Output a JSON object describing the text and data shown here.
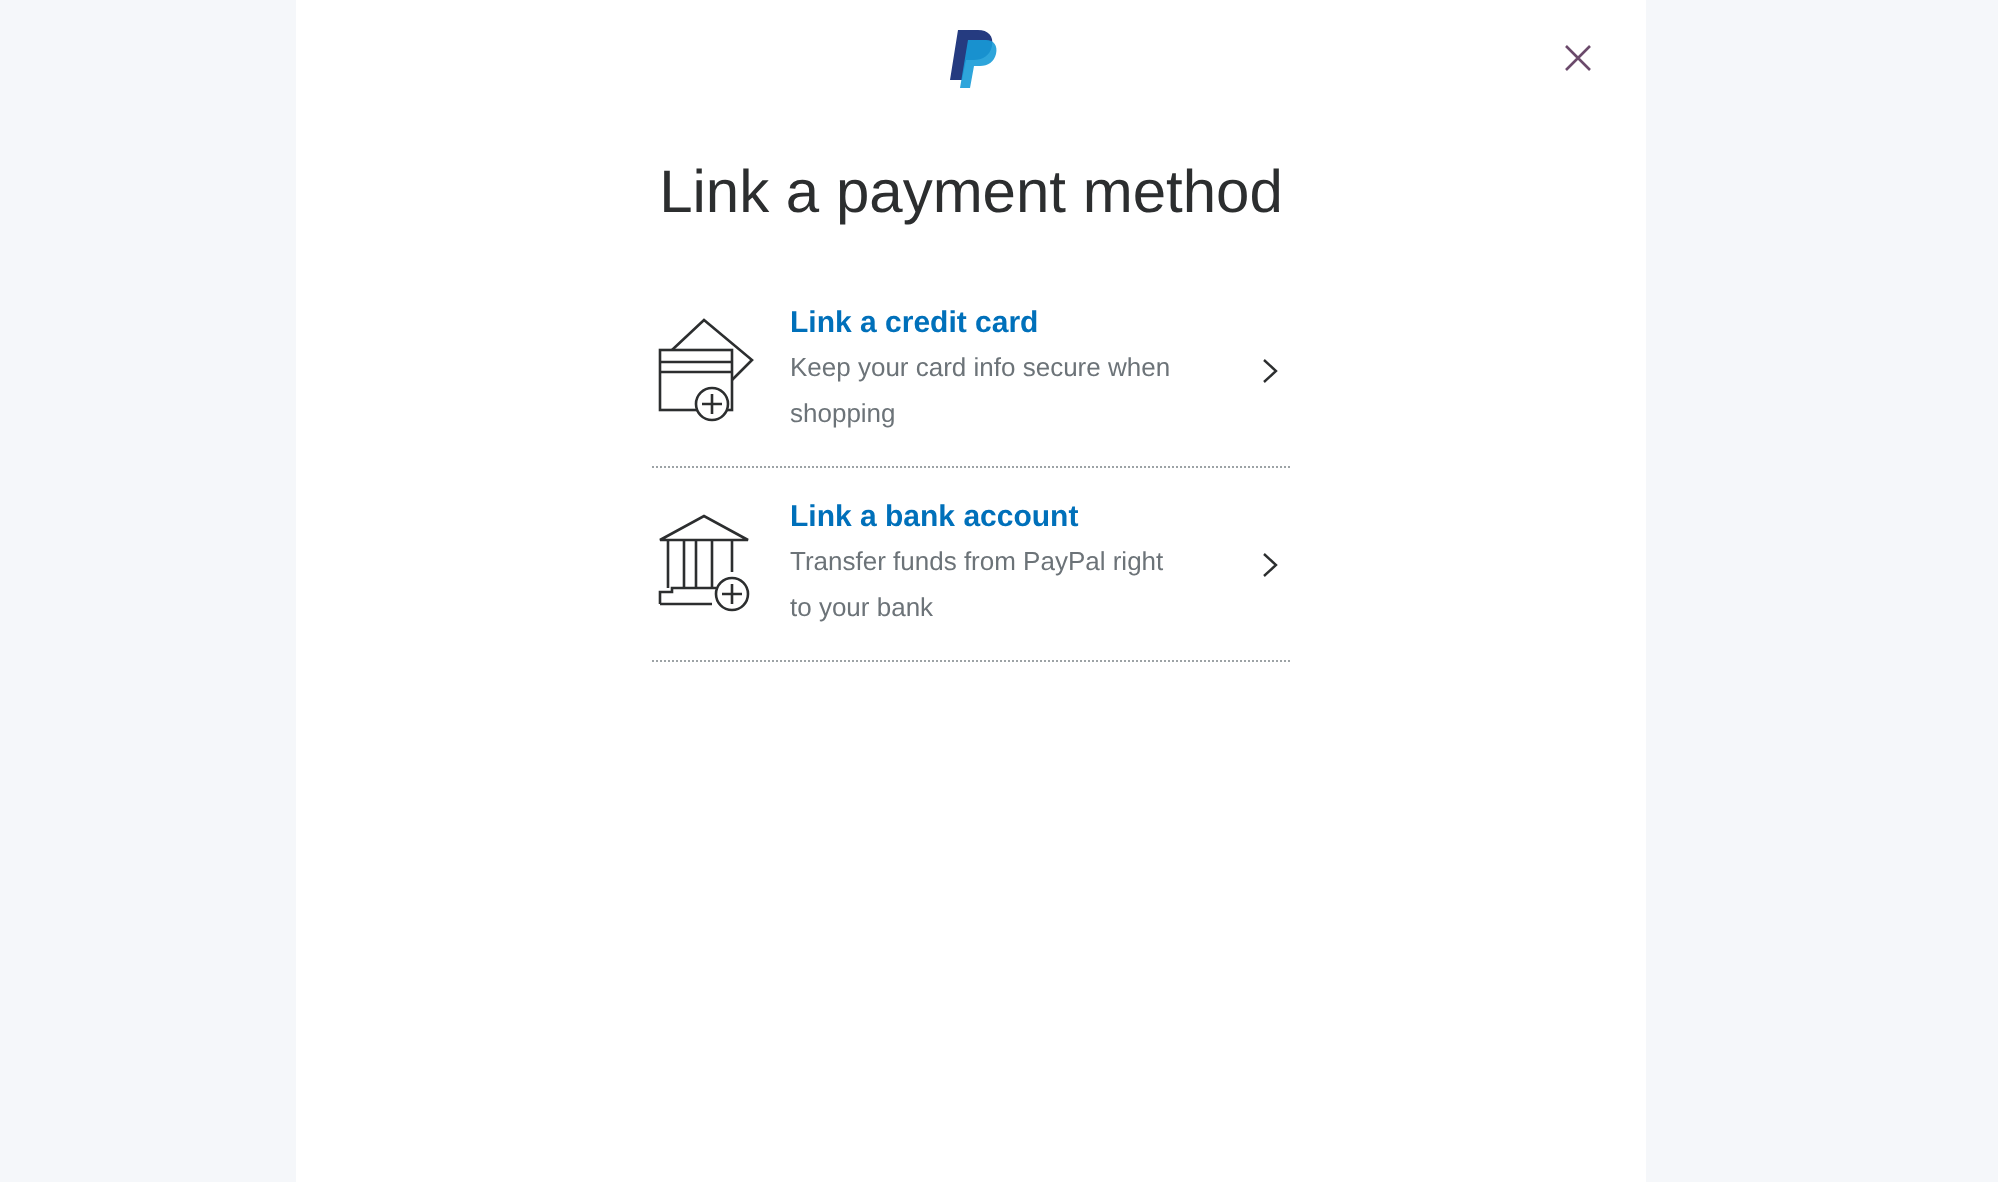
{
  "title": "Link a payment method",
  "options": [
    {
      "kind": "card",
      "title": "Link a credit card",
      "description": "Keep your card info secure when shopping"
    },
    {
      "kind": "bank",
      "title": "Link a bank account",
      "description": "Transfer funds from PayPal right to your bank"
    }
  ]
}
